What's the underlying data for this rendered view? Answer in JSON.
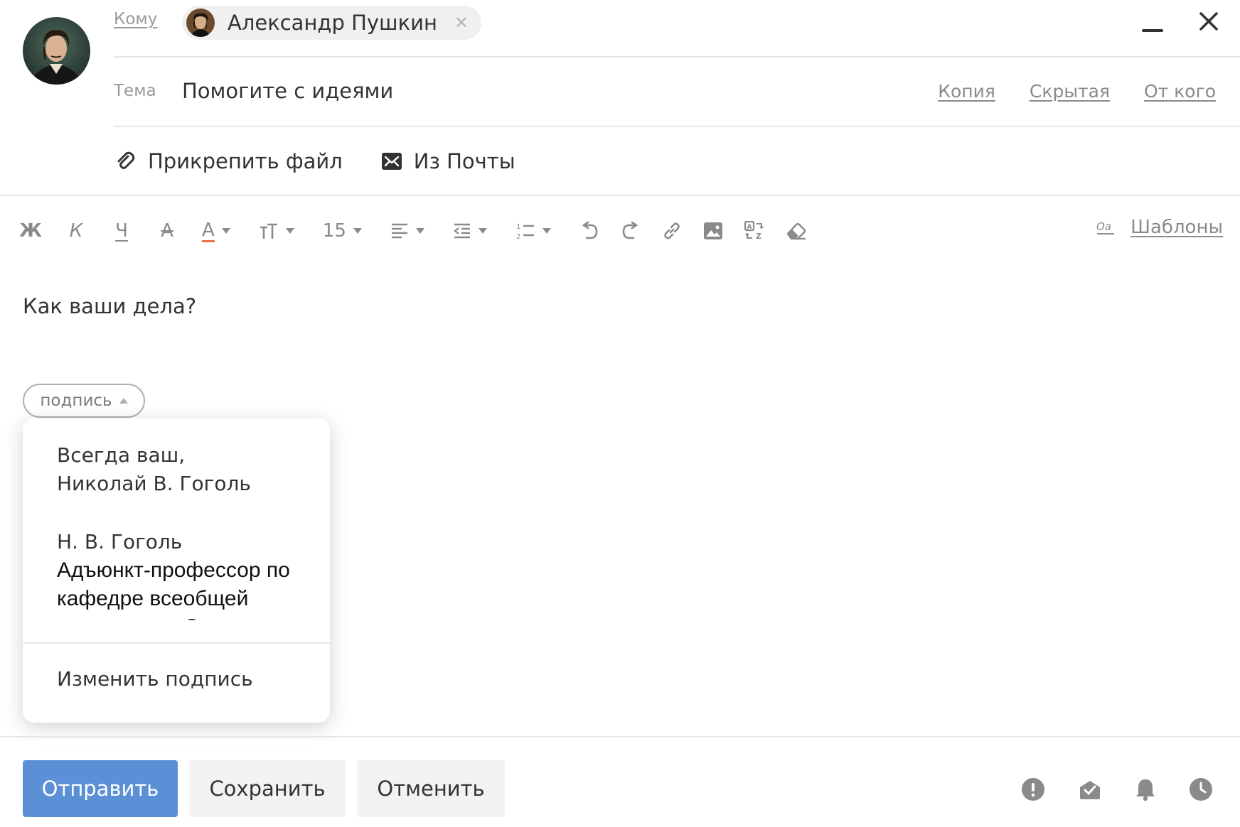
{
  "header": {
    "to_label": "Кому",
    "recipient": {
      "name": "Александр Пушкин",
      "remove_icon": "close-icon"
    },
    "subject_label": "Тема",
    "subject_value": "Помогите с идеями",
    "links": {
      "cc": "Копия",
      "bcc": "Скрытая",
      "from": "От кого"
    },
    "window_controls": [
      "minimize-icon",
      "close-icon"
    ]
  },
  "attachments": {
    "attach_file": "Прикрепить файл",
    "from_mail": "Из Почты"
  },
  "toolbar": {
    "bold": "Ж",
    "italic": "К",
    "underline": "Ч",
    "strike": "А",
    "text_color": "А",
    "font_size": "15",
    "templates": "Шаблоны"
  },
  "body": {
    "text": "Как ваши дела?"
  },
  "signature": {
    "button_label": "подпись",
    "options": [
      {
        "lines": [
          "Всегда ваш,",
          "Николай В. Гоголь"
        ]
      },
      {
        "name": "Н. В. Гоголь",
        "title_lines": [
          "Адъюнкт-профессор по",
          "кафедре всеобщей",
          "истории при Санкт-"
        ]
      }
    ],
    "edit_label": "Изменить подпись"
  },
  "footer": {
    "send": "Отправить",
    "save": "Сохранить",
    "cancel": "Отменить",
    "icons": [
      "important-icon",
      "receipt-icon",
      "reminder-icon",
      "schedule-icon"
    ]
  },
  "colors": {
    "accent": "#5b8fd6",
    "text": "#333333",
    "muted": "#8a8a8a",
    "divider": "#e6e6e6",
    "text_color_marker": "#e8714f"
  }
}
